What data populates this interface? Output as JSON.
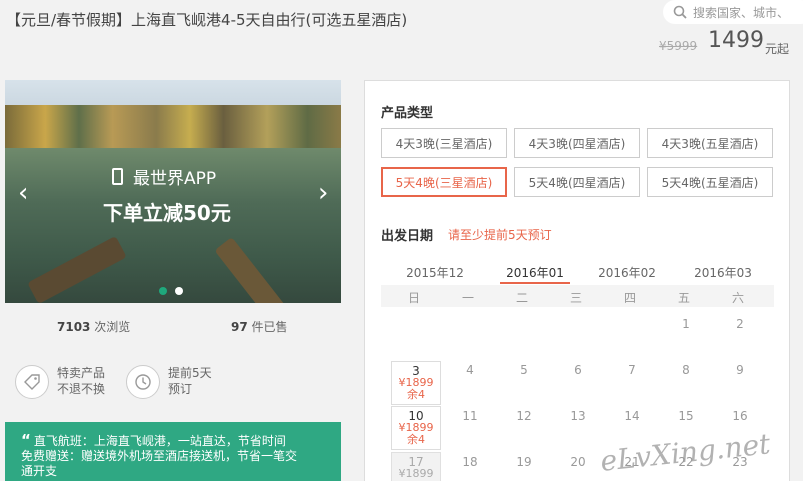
{
  "header": {
    "title": "【元旦/春节假期】上海直飞岘港4-5天自由行(可选五星酒店)",
    "search_placeholder": "搜索国家、城市、",
    "old_price": "¥5999",
    "price": "1499",
    "price_suffix": "元起"
  },
  "slider": {
    "app_text": "最世界APP",
    "main_text": "下单立减50元",
    "prev": "‹",
    "next": "›"
  },
  "stats": {
    "views": "7103",
    "views_label": "次浏览",
    "sold": "97",
    "sold_label": "件已售"
  },
  "features": [
    {
      "line1": "特卖产品",
      "line2": "不退不换",
      "icon": "tag-icon"
    },
    {
      "line1": "提前5天",
      "line2": "预订",
      "icon": "clock-icon"
    }
  ],
  "notice": {
    "quote": "“",
    "line1": "直飞航班：上海直飞岘港，一站直达，节省时间",
    "line2": "免费赠送：赠送境外机场至酒店接送机，节省一笔交",
    "line3": "通开支"
  },
  "product": {
    "type_label": "产品类型",
    "options": [
      "4天3晚(三星酒店)",
      "4天3晚(四星酒店)",
      "4天3晚(五星酒店)",
      "5天4晚(三星酒店)",
      "5天4晚(四星酒店)",
      "5天4晚(五星酒店)"
    ],
    "selected": 3
  },
  "departure": {
    "label": "出发日期",
    "hint": "请至少提前5天预订",
    "months": [
      "2015年12",
      "2016年01",
      "2016年02",
      "2016年03"
    ],
    "active_month": 1,
    "weekdays": [
      "日",
      "一",
      "二",
      "三",
      "四",
      "五",
      "六"
    ],
    "row1": [
      "1",
      "2"
    ],
    "row2": [
      "3",
      "4",
      "5",
      "6",
      "7",
      "8",
      "9"
    ],
    "row3": [
      "10",
      "11",
      "12",
      "13",
      "14",
      "15",
      "16"
    ],
    "row4": [
      "17",
      "18",
      "19",
      "20",
      "21",
      "22",
      "23"
    ],
    "price": "¥1899",
    "stock": "余4"
  },
  "watermark": "eLvXing.net",
  "colors": {
    "accent": "#e8654a",
    "green": "#2fa883"
  }
}
